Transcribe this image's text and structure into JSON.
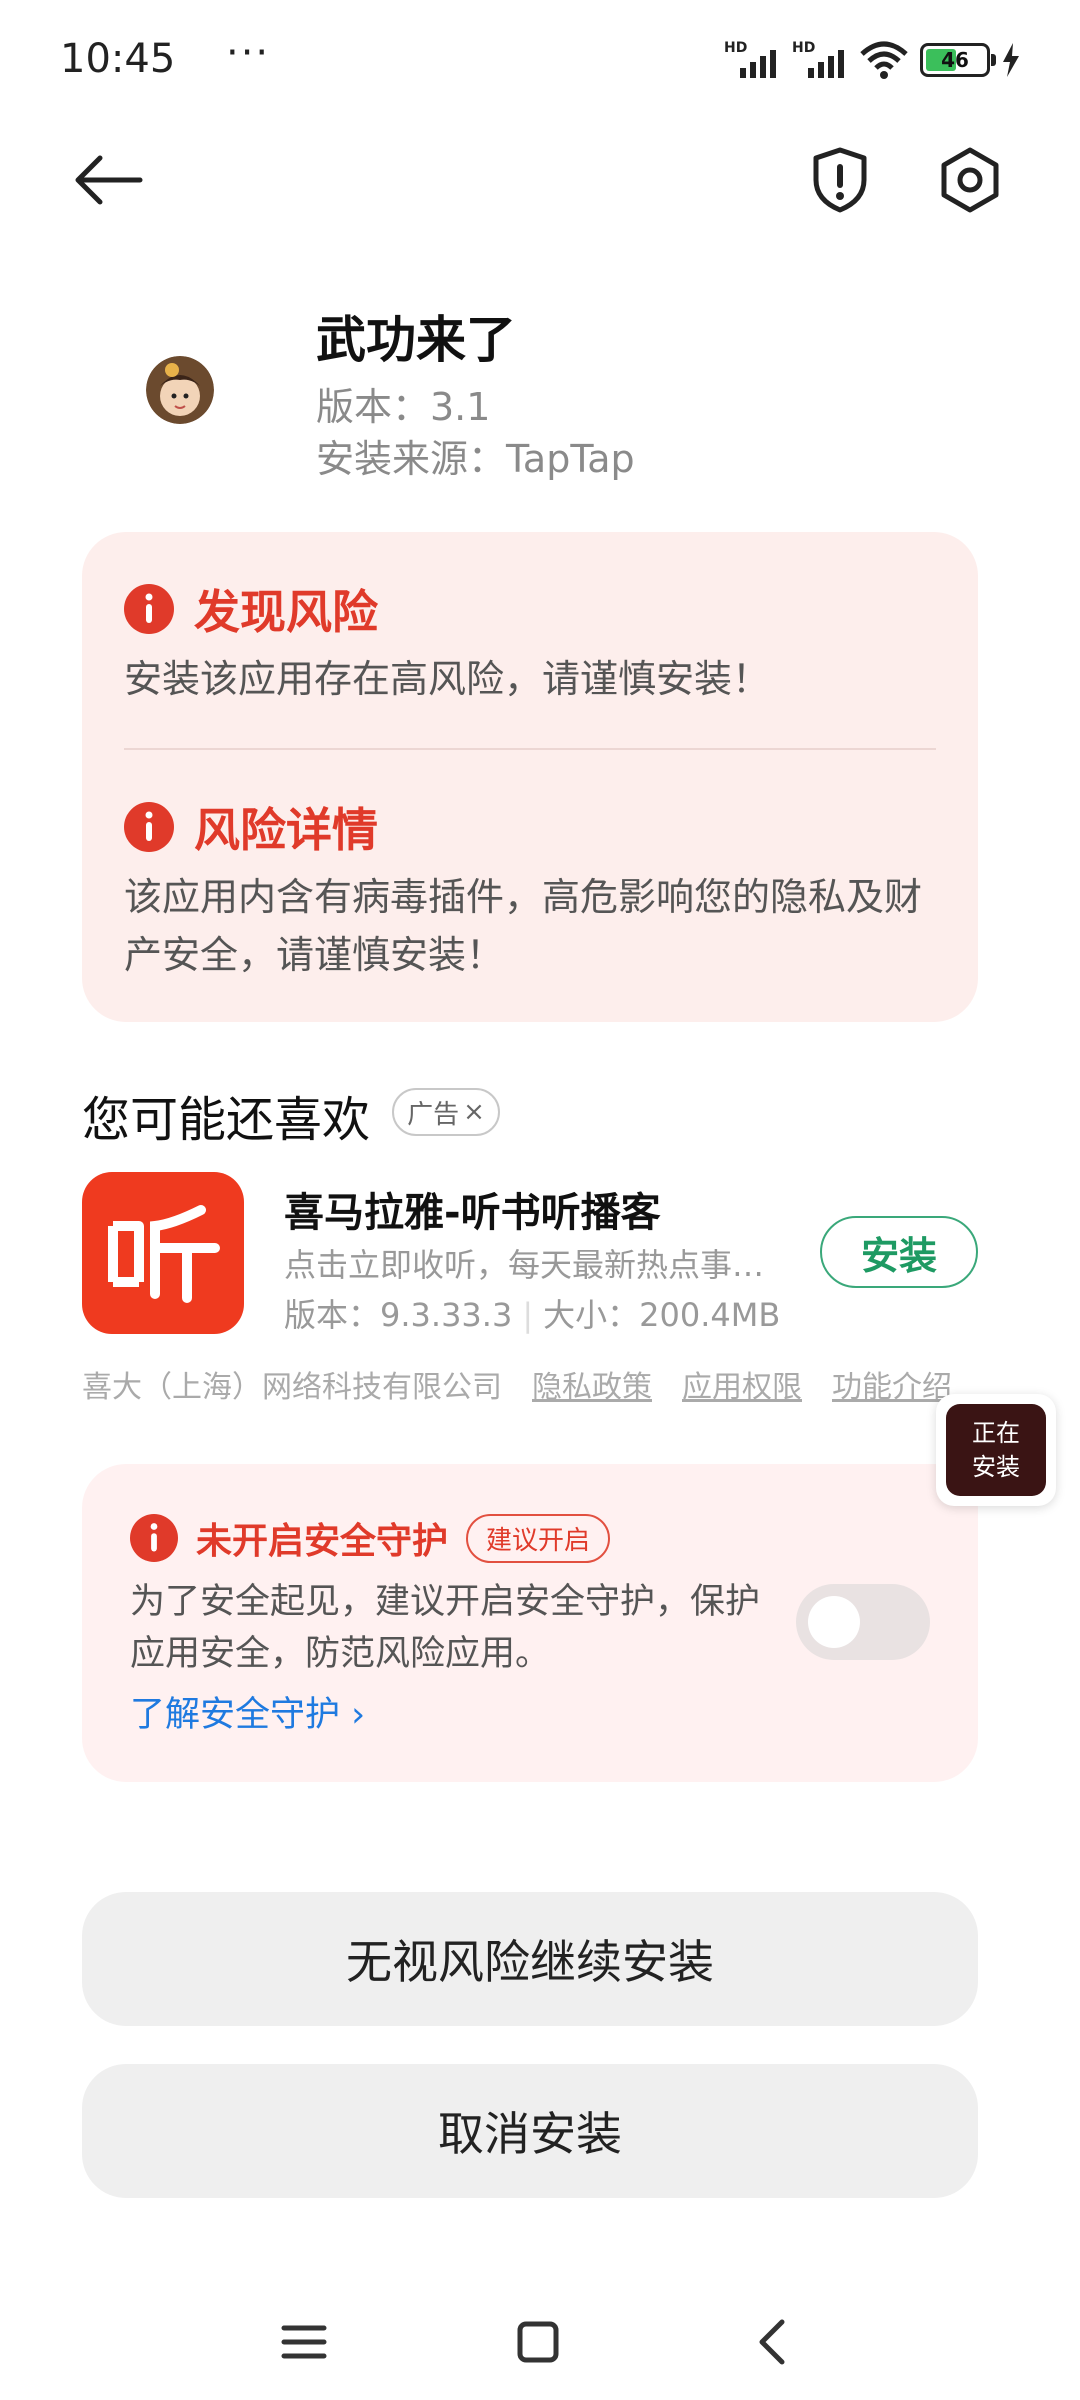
{
  "status_bar": {
    "time": "10:45",
    "dots": "···",
    "signal1_label": "HD",
    "signal2_label": "HD",
    "battery": "46"
  },
  "app": {
    "name": "武功来了",
    "version": "版本：3.1",
    "source": "安装来源：TapTap"
  },
  "risk": {
    "found_title": "发现风险",
    "found_text": "安装该应用存在高风险，请谨慎安装！",
    "detail_title": "风险详情",
    "detail_line1": "该应用内含有病毒插件，高危影响您的隐私及财",
    "detail_line2": "产安全，请谨慎安装！"
  },
  "recommend": {
    "title": "您可能还喜欢",
    "ad_label": "广告",
    "ad_close": "×",
    "app_name": "喜马拉雅-听书听播客",
    "app_desc": "点击立即收听，每天最新热点事件全...",
    "app_version": "版本：9.3.33.3",
    "app_size": "大小：200.4MB",
    "install_label": "安装",
    "developer": "喜大（上海）网络科技有限公司",
    "privacy": "隐私政策",
    "permissions": "应用权限",
    "features": "功能介绍"
  },
  "floating": {
    "line1": "正在",
    "line2": "安装"
  },
  "protect": {
    "title": "未开启安全守护",
    "badge": "建议开启",
    "line1": "为了安全起见，建议开启安全守护，保护",
    "line2": "应用安全，防范风险应用。",
    "link": "了解安全守护 ›",
    "toggle_on": false
  },
  "actions": {
    "continue": "无视风险继续安装",
    "cancel": "取消安装"
  },
  "colors": {
    "risk_red": "#e03a2a",
    "install_green": "#1e9a63",
    "link_blue": "#1f7ae0",
    "ximalaya_red": "#ef3a1f"
  }
}
